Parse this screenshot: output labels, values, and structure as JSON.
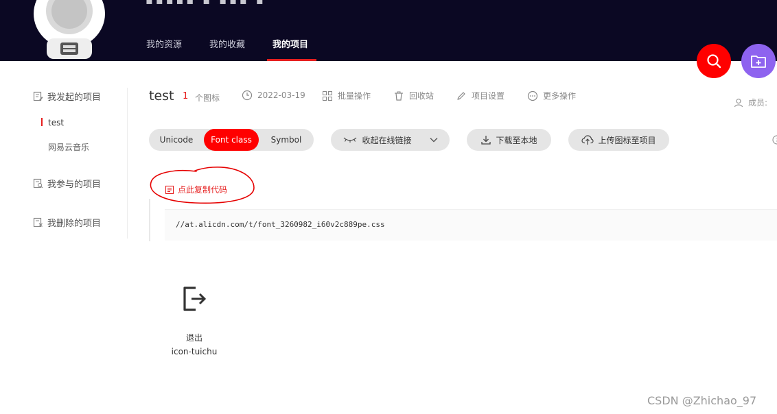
{
  "header": {
    "nav": [
      {
        "label": "我的资源"
      },
      {
        "label": "我的收藏"
      },
      {
        "label": "我的项目"
      }
    ]
  },
  "sidebar": {
    "my_projects": "我发起的项目",
    "sub_items": [
      {
        "label": "test"
      },
      {
        "label": "网易云音乐"
      }
    ],
    "joined_projects": "我参与的项目",
    "deleted_projects": "我删除的项目"
  },
  "project": {
    "name": "test",
    "icon_count": "1",
    "icon_count_label": "个图标",
    "date": "2022-03-19",
    "batch": "批量操作",
    "recycle": "回收站",
    "settings": "项目设置",
    "more": "更多操作",
    "members_label": "成员:"
  },
  "toolbar": {
    "formats": [
      {
        "label": "Unicode"
      },
      {
        "label": "Font class"
      },
      {
        "label": "Symbol"
      }
    ],
    "active_format": "Font class",
    "collapse_link": "收起在线链接",
    "download": "下载至本地",
    "upload": "上传图标至项目"
  },
  "code": {
    "copy_label": "点此复制代码",
    "url": "//at.alicdn.com/t/font_3260982_i60v2c889pe.css"
  },
  "icons": [
    {
      "name": "退出",
      "class": "icon-tuichu",
      "icon": "logout-icon"
    }
  ],
  "watermark": "CSDN @Zhichao_97",
  "colors": {
    "header_bg": "#0b0823",
    "accent_red": "#ff0000",
    "purple": "#8e63ef",
    "pill_bg": "#e5e5e5"
  }
}
